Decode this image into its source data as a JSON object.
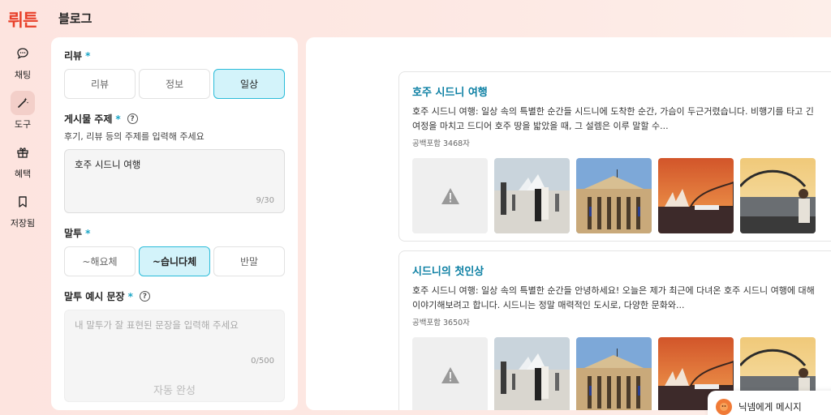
{
  "brand": {
    "logo": "뤼튼"
  },
  "sidebar": {
    "items": [
      {
        "label": "채팅",
        "icon": "chat-bubble-icon"
      },
      {
        "label": "도구",
        "icon": "magic-wand-icon",
        "active": true
      },
      {
        "label": "혜택",
        "icon": "gift-icon"
      },
      {
        "label": "저장됨",
        "icon": "bookmark-icon"
      }
    ]
  },
  "header": {
    "title": "블로그"
  },
  "form": {
    "review": {
      "label": "리뷰",
      "required": "*",
      "options": [
        "리뷰",
        "정보",
        "일상"
      ],
      "selected": "일상"
    },
    "topic": {
      "label": "게시물 주제",
      "required": "*",
      "hint": "후기, 리뷰 등의 주제를 입력해 주세요",
      "value": "호주 시드니 여행",
      "counter": "9/30"
    },
    "tone": {
      "label": "말투",
      "required": "*",
      "options": [
        "~해요체",
        "~습니다체",
        "반말"
      ],
      "selected": "~습니다체"
    },
    "example": {
      "label": "말투 예시 문장",
      "required": "*",
      "placeholder": "내 말투가 잘 표현된 문장을 입력해 주세요",
      "counter": "0/500",
      "autocomplete_label": "자동 완성"
    }
  },
  "posts": [
    {
      "title": "호주 시드니 여행",
      "body": "호주 시드니 여행: 일상 속의 특별한 순간들 시드니에 도착한 순간, 가슴이 두근거렸습니다. 비행기를 타고 긴 여정을 마치고 드디어 호주 땅을 밟았을 때, 그 설렘은 이루 말할 수...",
      "count": "공백포함 3468자"
    },
    {
      "title": "시드니의 첫인상",
      "body": "호주 시드니 여행: 일상 속의 특별한 순간들 안녕하세요! 오늘은 제가 최근에 다녀온 호주 시드니 여행에 대해 이야기해보려고 합니다. 시드니는 정말 매력적인 도시로, 다양한 문화와...",
      "count": "공백포함 3650자"
    }
  ],
  "thumbnails": [
    "image-placeholder-icon",
    "opera-house-crowd",
    "museum-building",
    "opera-house-sunset",
    "harbour-bridge-portrait"
  ],
  "message_widget": {
    "label": "닉넴에게 메시지"
  },
  "colors": {
    "accent": "#1aa5c6",
    "brand": "#e8402a",
    "post_title": "#0b7fa3"
  }
}
